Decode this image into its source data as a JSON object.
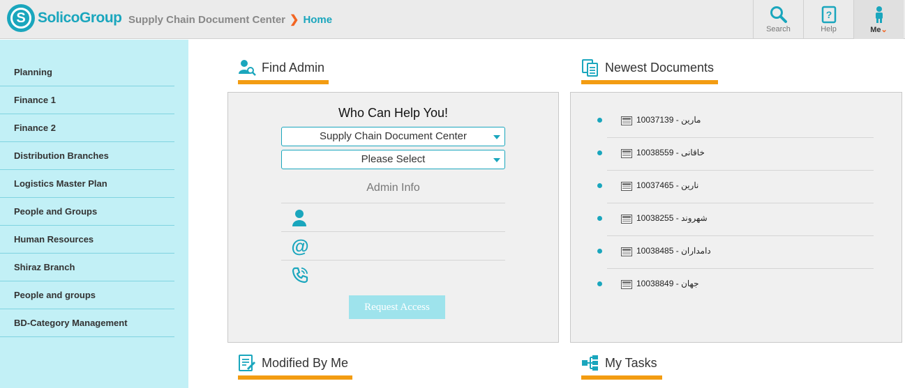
{
  "brand": {
    "name": "SolicoGroup",
    "mark": "S"
  },
  "breadcrumb": {
    "section": "Supply Chain Document Center",
    "separator": "❯",
    "current": "Home"
  },
  "toolbar": {
    "search_label": "Search",
    "help_label": "Help",
    "me_label": "Me",
    "me_chevron": "⌄"
  },
  "sidebar": {
    "items": [
      {
        "label": "Planning"
      },
      {
        "label": "Finance 1"
      },
      {
        "label": "Finance 2"
      },
      {
        "label": "Distribution Branches"
      },
      {
        "label": "Logistics Master Plan"
      },
      {
        "label": "People and Groups"
      },
      {
        "label": "Human Resources"
      },
      {
        "label": "Shiraz Branch"
      },
      {
        "label": "People and groups"
      },
      {
        "label": "BD-Category Management"
      }
    ]
  },
  "find_admin": {
    "title": "Find Admin",
    "heading": "Who Can Help You!",
    "site_select": "Supply Chain Document Center",
    "person_select": "Please Select",
    "admin_info_label": "Admin Info",
    "request_button": "Request Access"
  },
  "newest_documents": {
    "title": "Newest Documents",
    "items": [
      {
        "label": "10037139 - مارین"
      },
      {
        "label": "10038559 - خاقانی"
      },
      {
        "label": "10037465 - نارین"
      },
      {
        "label": "10038255 - شهروند"
      },
      {
        "label": "10038485 - دامداران"
      },
      {
        "label": "10038849 - جهان"
      }
    ]
  },
  "modified_by_me": {
    "title": "Modified By Me"
  },
  "my_tasks": {
    "title": "My Tasks"
  },
  "colors": {
    "accent": "#1aa6bd",
    "orange": "#f39c12",
    "sidebar_bg": "#c2f0f6",
    "chevron": "#f26522"
  }
}
